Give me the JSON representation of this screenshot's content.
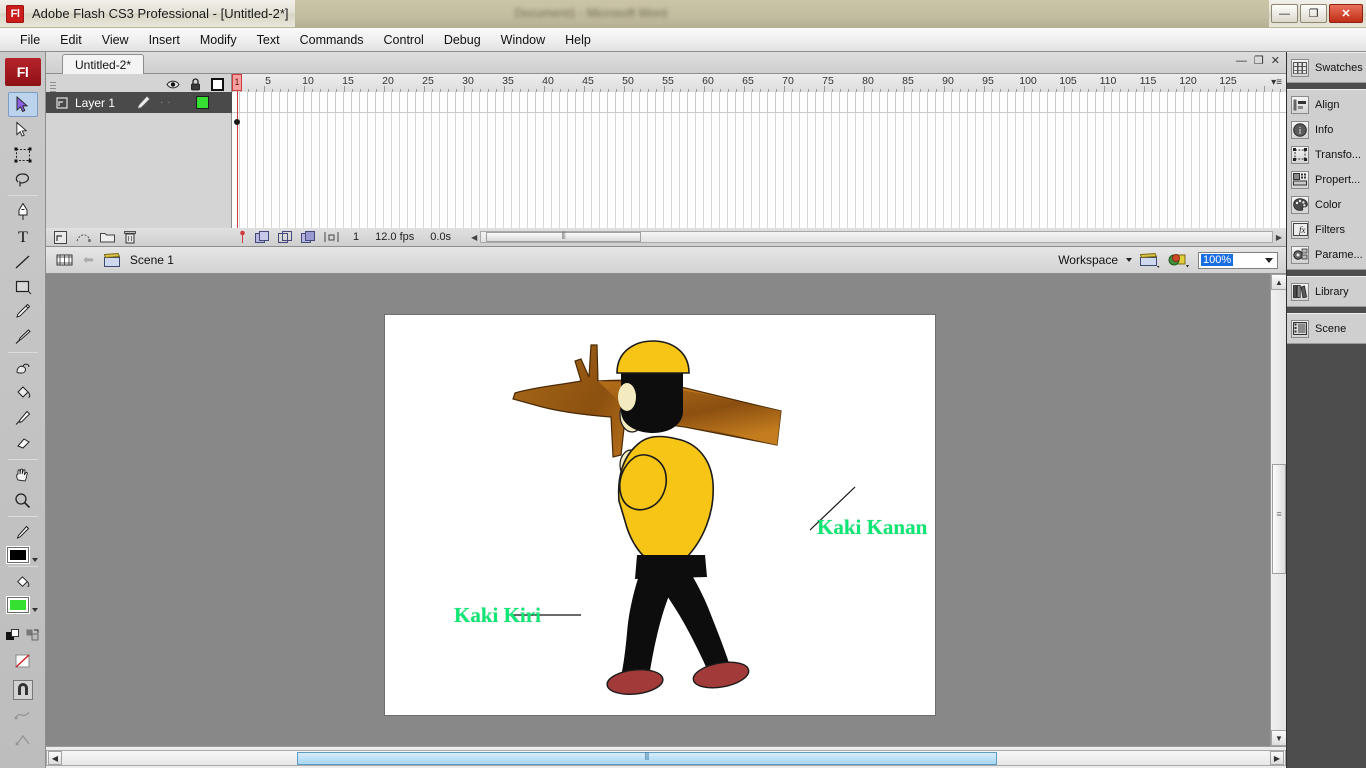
{
  "window": {
    "title": "Adobe Flash CS3 Professional - [Untitled-2*]",
    "app_badge": "Fl",
    "background_ghost_text": "Document1 - Microsoft Word",
    "minimize": "—",
    "maximize": "❐",
    "close": "✕"
  },
  "menubar": {
    "items": [
      {
        "label": "File"
      },
      {
        "label": "Edit"
      },
      {
        "label": "View"
      },
      {
        "label": "Insert"
      },
      {
        "label": "Modify"
      },
      {
        "label": "Text"
      },
      {
        "label": "Commands"
      },
      {
        "label": "Control"
      },
      {
        "label": "Debug"
      },
      {
        "label": "Window"
      },
      {
        "label": "Help"
      }
    ]
  },
  "toolbar": {
    "logo": "Fl",
    "tools": [
      {
        "name": "selection-tool",
        "active": true
      },
      {
        "name": "subselection-tool",
        "active": false
      },
      {
        "name": "free-transform-tool",
        "active": false
      },
      {
        "name": "lasso-tool",
        "active": false
      },
      {
        "name": "pen-tool",
        "active": false
      },
      {
        "name": "text-tool",
        "active": false
      },
      {
        "name": "line-tool",
        "active": false
      },
      {
        "name": "rectangle-tool",
        "active": false
      },
      {
        "name": "pencil-tool",
        "active": false
      },
      {
        "name": "brush-tool",
        "active": false
      },
      {
        "name": "deco-tool",
        "active": false
      },
      {
        "name": "paint-bucket-tool",
        "active": false
      },
      {
        "name": "eyedropper-tool",
        "active": false
      },
      {
        "name": "eraser-tool",
        "active": false
      },
      {
        "name": "hand-tool",
        "active": false
      },
      {
        "name": "zoom-tool",
        "active": false
      }
    ],
    "stroke_color": "#000000",
    "fill_color": "#35e033",
    "options": [
      {
        "name": "snap-to-objects",
        "active": true
      },
      {
        "name": "smooth-option",
        "active": false
      },
      {
        "name": "straighten-option",
        "active": false
      }
    ]
  },
  "document": {
    "tab_label": "Untitled-2*",
    "panel_minimize": "—",
    "panel_restore": "❐",
    "panel_close": "✕"
  },
  "timeline": {
    "layer": {
      "name": "Layer 1",
      "outline_color": "#35e033"
    },
    "column_icons": [
      "eye-icon",
      "lock-icon",
      "outline-icon"
    ],
    "ruler_labels": [
      "1",
      "5",
      "10",
      "15",
      "20",
      "25",
      "30",
      "35",
      "40",
      "45",
      "50",
      "55",
      "60",
      "65",
      "70",
      "75",
      "80",
      "85",
      "90",
      "95",
      "100",
      "105",
      "110",
      "115",
      "120",
      "125"
    ],
    "current_frame": "1",
    "frame_rate": "12.0 fps",
    "elapsed_time": "0.0s",
    "footer_buttons": [
      "new-layer",
      "add-motion-guide",
      "new-folder",
      "delete-layer"
    ],
    "onion_buttons": [
      "onion-skin",
      "onion-skin-outlines",
      "edit-multiple-frames",
      "modify-onion-markers"
    ]
  },
  "editbar": {
    "scene_label": "Scene 1",
    "workspace_label": "Workspace",
    "zoom_value": "100%"
  },
  "stage": {
    "labels": [
      {
        "text": "Kaki Kanan",
        "color": "#0de874"
      },
      {
        "text": "Kaki Kiri",
        "color": "#0de874"
      }
    ],
    "colors": {
      "shirt": "#f6c516",
      "cap": "#f6c516",
      "hair": "#0d0d0d",
      "pants": "#0d0d0d",
      "shoes": "#a23a3a",
      "branch_light": "#c98420",
      "branch_dark": "#7a4410",
      "skin": "#f3eac0"
    }
  },
  "rightdock": {
    "groups": [
      {
        "items": [
          {
            "label": "Swatches",
            "icon": "swatches-icon"
          }
        ]
      },
      {
        "items": [
          {
            "label": "Align",
            "icon": "align-icon"
          },
          {
            "label": "Info",
            "icon": "info-icon"
          },
          {
            "label": "Transfo...",
            "icon": "transform-icon"
          },
          {
            "label": "Propert...",
            "icon": "properties-icon"
          },
          {
            "label": "Color",
            "icon": "color-icon"
          },
          {
            "label": "Filters",
            "icon": "filters-icon"
          },
          {
            "label": "Parame...",
            "icon": "parameters-icon"
          }
        ]
      },
      {
        "items": [
          {
            "label": "Library",
            "icon": "library-icon"
          }
        ]
      },
      {
        "items": [
          {
            "label": "Scene",
            "icon": "scene-icon"
          }
        ]
      }
    ]
  }
}
